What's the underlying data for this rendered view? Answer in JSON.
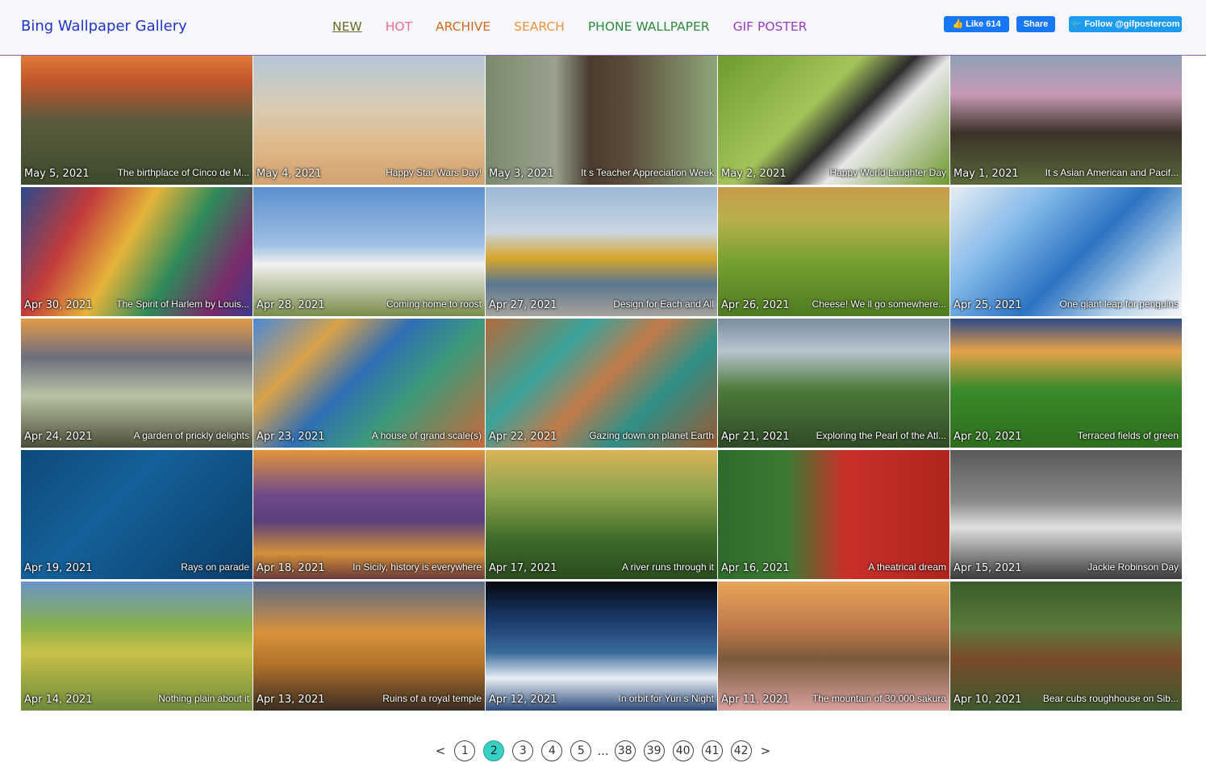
{
  "header": {
    "brand": "Bing Wallpaper Gallery",
    "nav": [
      {
        "label": "NEW",
        "color": "#6b6b2a",
        "active": true
      },
      {
        "label": "HOT",
        "color": "#ee6e8e",
        "active": false
      },
      {
        "label": "ARCHIVE",
        "color": "#d2691e",
        "active": false
      },
      {
        "label": "SEARCH",
        "color": "#f0913c",
        "active": false
      },
      {
        "label": "PHONE WALLPAPER",
        "color": "#2e8b3d",
        "active": false
      },
      {
        "label": "GIF POSTER",
        "color": "#9b3cc4",
        "active": false
      }
    ],
    "social": {
      "like": "Like 614",
      "share": "Share",
      "follow": "Follow @gifpostercom"
    }
  },
  "tiles": [
    {
      "date": "May 5, 2021",
      "caption": "The birthplace of Cinco de M...",
      "bg": "linear-gradient(180deg,#e27b3a 0%,#c2552a 20%,#5b5b3e 50%,#3d4a2c 100%)"
    },
    {
      "date": "May 4, 2021",
      "caption": "Happy Star Wars Day!",
      "bg": "linear-gradient(180deg,#b4c7d8 0%,#d9ccb3 40%,#e0b889 70%,#cfa271 100%)"
    },
    {
      "date": "May 3, 2021",
      "caption": "It s Teacher Appreciation Week",
      "bg": "linear-gradient(90deg,#7a8a6e 0%,#9aa18d 30%,#4a3c2e 45%,#5a4a3a 60%,#8ea67a 100%)"
    },
    {
      "date": "May 2, 2021",
      "caption": "Happy World Laughter Day",
      "bg": "linear-gradient(135deg,#6e9a2e 0%,#a3c45a 40%,#2c2c2c 55%,#e8e8e8 65%,#6e9a2e 100%)"
    },
    {
      "date": "May 1, 2021",
      "caption": "It s Asian American and Pacif...",
      "bg": "linear-gradient(180deg,#8fa0b5 0%,#c79ab6 30%,#3b3127 60%,#5a6a3c 100%)"
    },
    {
      "date": "Apr 30, 2021",
      "caption": "The Spirit of Harlem by Louis...",
      "bg": "linear-gradient(120deg,#2b4a8a 0%,#c23b3b 25%,#e6b43a 45%,#2e8a5a 65%,#7a2b6b 85%,#3b3b8a 100%)"
    },
    {
      "date": "Apr 28, 2021",
      "caption": "Coming home to roost",
      "bg": "linear-gradient(180deg,#5c8fd0 0%,#9fc0e4 45%,#f2f2f0 60%,#7a8c4a 100%)"
    },
    {
      "date": "Apr 27, 2021",
      "caption": "Design for Each and All",
      "bg": "linear-gradient(180deg,#9db8d6 0%,#c9d6e2 35%,#d8a62c 55%,#5b7791 75%,#a7a39b 100%)"
    },
    {
      "date": "Apr 26, 2021",
      "caption": "Cheese! We ll go somewhere...",
      "bg": "linear-gradient(180deg,#c89a4a 0%,#b9b04e 25%,#7aa232 55%,#4e7a22 100%)"
    },
    {
      "date": "Apr 25, 2021",
      "caption": "One giant leap for penguins",
      "bg": "linear-gradient(135deg,#e8eef4 0%,#7fb6e8 30%,#2b73c2 55%,#b8d3ea 80%,#f2f5f8 100%)"
    },
    {
      "date": "Apr 24, 2021",
      "caption": "A garden of prickly delights",
      "bg": "linear-gradient(180deg,#e39a48 0%,#6d6e7e 30%,#b9c2a6 60%,#4a4e38 100%)"
    },
    {
      "date": "Apr 23, 2021",
      "caption": "A house of grand scale(s)",
      "bg": "linear-gradient(135deg,#4a88d8 0%,#d8a24a 25%,#2f6fb5 45%,#3c9a7a 65%,#c96a3a 100%)"
    },
    {
      "date": "Apr 22, 2021",
      "caption": "Gazing down on planet Earth",
      "bg": "linear-gradient(135deg,#b36a3a 0%,#3aa39a 30%,#c27a4a 50%,#2f8f86 70%,#9a5a32 100%)"
    },
    {
      "date": "Apr 21, 2021",
      "caption": "Exploring the Pearl of the Atl...",
      "bg": "linear-gradient(180deg,#7a8c9e 0%,#b6c4cf 25%,#4e7a3a 55%,#2e4a26 100%)"
    },
    {
      "date": "Apr 20, 2021",
      "caption": "Terraced fields of green",
      "bg": "linear-gradient(180deg,#2c4a8a 0%,#e6a24a 25%,#3a8a2a 55%,#2e6e1e 100%)"
    },
    {
      "date": "Apr 19, 2021",
      "caption": "Rays on parade",
      "bg": "linear-gradient(135deg,#0d4a7a 0%,#14609a 40%,#0b3d68 100%)"
    },
    {
      "date": "Apr 18, 2021",
      "caption": "In Sicily, history is everywhere",
      "bg": "linear-gradient(180deg,#e2943a 0%,#6e4a8a 35%,#5a3f7a 55%,#d4903a 80%,#6a3a3a 100%)"
    },
    {
      "date": "Apr 17, 2021",
      "caption": "A river runs through it",
      "bg": "linear-gradient(180deg,#d9b45a 0%,#8aa24a 35%,#3e6a2a 70%,#2a4a1e 100%)"
    },
    {
      "date": "Apr 16, 2021",
      "caption": "A theatrical dream",
      "bg": "linear-gradient(90deg,#2e6a2a 0%,#3c7a32 30%,#c9302a 55%,#b0241e 100%)"
    },
    {
      "date": "Apr 15, 2021",
      "caption": "Jackie Robinson Day",
      "bg": "linear-gradient(180deg,#5a5a5a 0%,#8a8a8a 40%,#e0e0e0 60%,#3a3a3a 100%)"
    },
    {
      "date": "Apr 14, 2021",
      "caption": "Nothing plain about it",
      "bg": "linear-gradient(180deg,#6a94c8 0%,#8ab04a 35%,#c9c24a 55%,#6e8a3a 100%)"
    },
    {
      "date": "Apr 13, 2021",
      "caption": "Ruins of a royal temple",
      "bg": "linear-gradient(180deg,#5a6a8a 0%,#d8923a 40%,#b0702a 65%,#3a2e22 100%)"
    },
    {
      "date": "Apr 12, 2021",
      "caption": "In orbit for Yuri s Night",
      "bg": "linear-gradient(180deg,#05080f 0%,#1a3a6a 30%,#3a6a9a 55%,#e8eef4 75%,#2a4a7a 100%)"
    },
    {
      "date": "Apr 11, 2021",
      "caption": "The mountain of 30,000 sakura",
      "bg": "linear-gradient(180deg,#e8a45a 0%,#c07a4a 35%,#7a5a3a 60%,#d9a0a0 100%)"
    },
    {
      "date": "Apr 10, 2021",
      "caption": "Bear cubs roughhouse on Sib...",
      "bg": "linear-gradient(180deg,#3a5a2a 0%,#5a7a3a 35%,#7a4a2a 60%,#3e5a2e 100%)"
    }
  ],
  "pager": {
    "prev": "<",
    "next": ">",
    "pages": [
      "1",
      "2",
      "3",
      "4",
      "5"
    ],
    "current": "2",
    "ellipsis": "...",
    "last_pages": [
      "38",
      "39",
      "40",
      "41",
      "42"
    ]
  }
}
